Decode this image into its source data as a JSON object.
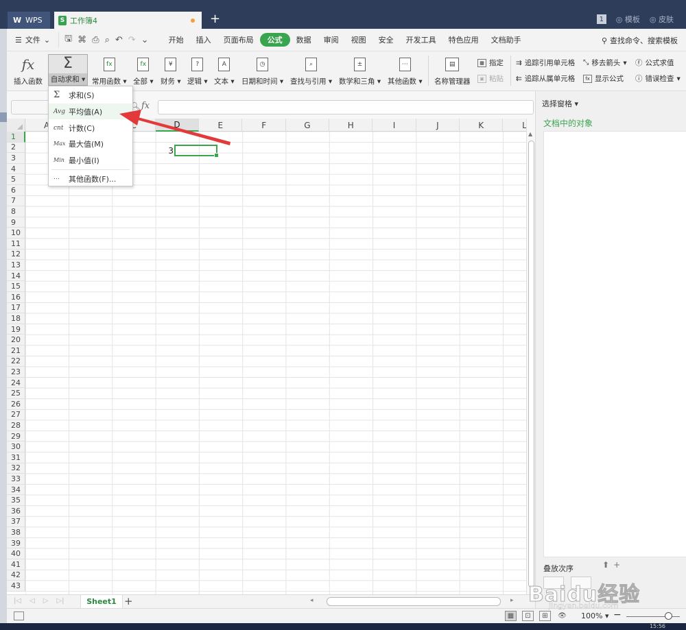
{
  "titlebar": {
    "app_tab": "WPS",
    "doc_tab": "工作簿4",
    "doc_icon": "S",
    "new_tab": "+",
    "badge": "1",
    "template_label": "模板",
    "skin_label": "皮肤"
  },
  "menubar": {
    "file_label": "文件",
    "tabs": [
      "开始",
      "插入",
      "页面布局",
      "公式",
      "数据",
      "审阅",
      "视图",
      "安全",
      "开发工具",
      "特色应用",
      "文档助手"
    ],
    "active_tab": "公式",
    "search_label": "查找命令、搜索模板"
  },
  "ribbon": {
    "insert_function": "插入函数",
    "autosum": "自动求和",
    "common_functions": "常用函数",
    "all": "全部",
    "finance": "财务",
    "logic": "逻辑",
    "text": "文本",
    "datetime": "日期和时间",
    "lookup": "查找与引用",
    "math": "数学和三角",
    "other": "其他函数",
    "name_manager": "名称管理器",
    "specify": "指定",
    "paste": "粘贴",
    "trace_precedents": "追踪引用单元格",
    "trace_dependents": "追踪从属单元格",
    "remove_arrows": "移去箭头",
    "show_formulas": "显示公式",
    "evaluate": "公式求值",
    "error_check": "错误检查"
  },
  "formula_bar": {
    "fx": "fx",
    "value": ""
  },
  "grid": {
    "columns": [
      "A",
      "B",
      "C",
      "D",
      "E",
      "F",
      "G",
      "H",
      "I",
      "J",
      "K",
      "L"
    ],
    "selected_column": "D",
    "rows": [
      "1",
      "2",
      "3",
      "4",
      "5",
      "6",
      "7",
      "8",
      "9",
      "10",
      "11",
      "12",
      "13",
      "14",
      "15",
      "16",
      "17",
      "18",
      "19",
      "20",
      "21",
      "22",
      "23",
      "24",
      "25",
      "26",
      "27",
      "28",
      "29",
      "30",
      "31",
      "32",
      "33",
      "34",
      "35",
      "36",
      "37",
      "38",
      "39",
      "40",
      "41",
      "42",
      "43"
    ],
    "selected_row": "1",
    "cell_c1": "3"
  },
  "dropdown": {
    "items": [
      {
        "icon": "Σ",
        "label": "求和(S)"
      },
      {
        "icon": "Avg",
        "label": "平均值(A)"
      },
      {
        "icon": "cnt",
        "label": "计数(C)"
      },
      {
        "icon": "Max",
        "label": "最大值(M)"
      },
      {
        "icon": "Min",
        "label": "最小值(I)"
      },
      {
        "icon": "⋯",
        "label": "其他函数(F)..."
      }
    ]
  },
  "sheets": {
    "active": "Sheet1",
    "add": "+"
  },
  "right_pane": {
    "header": "选择窗格",
    "title": "文档中的对象",
    "order_label": "叠放次序"
  },
  "status": {
    "zoom": "100%"
  },
  "watermark": {
    "text": "Baidu经验",
    "url": "jingyan.baidu.com"
  },
  "taskbar": {
    "time": "15:56"
  },
  "colors": {
    "accent": "#3aa54f",
    "titlebar": "#2e3d59",
    "arrow": "#e23a3a"
  }
}
